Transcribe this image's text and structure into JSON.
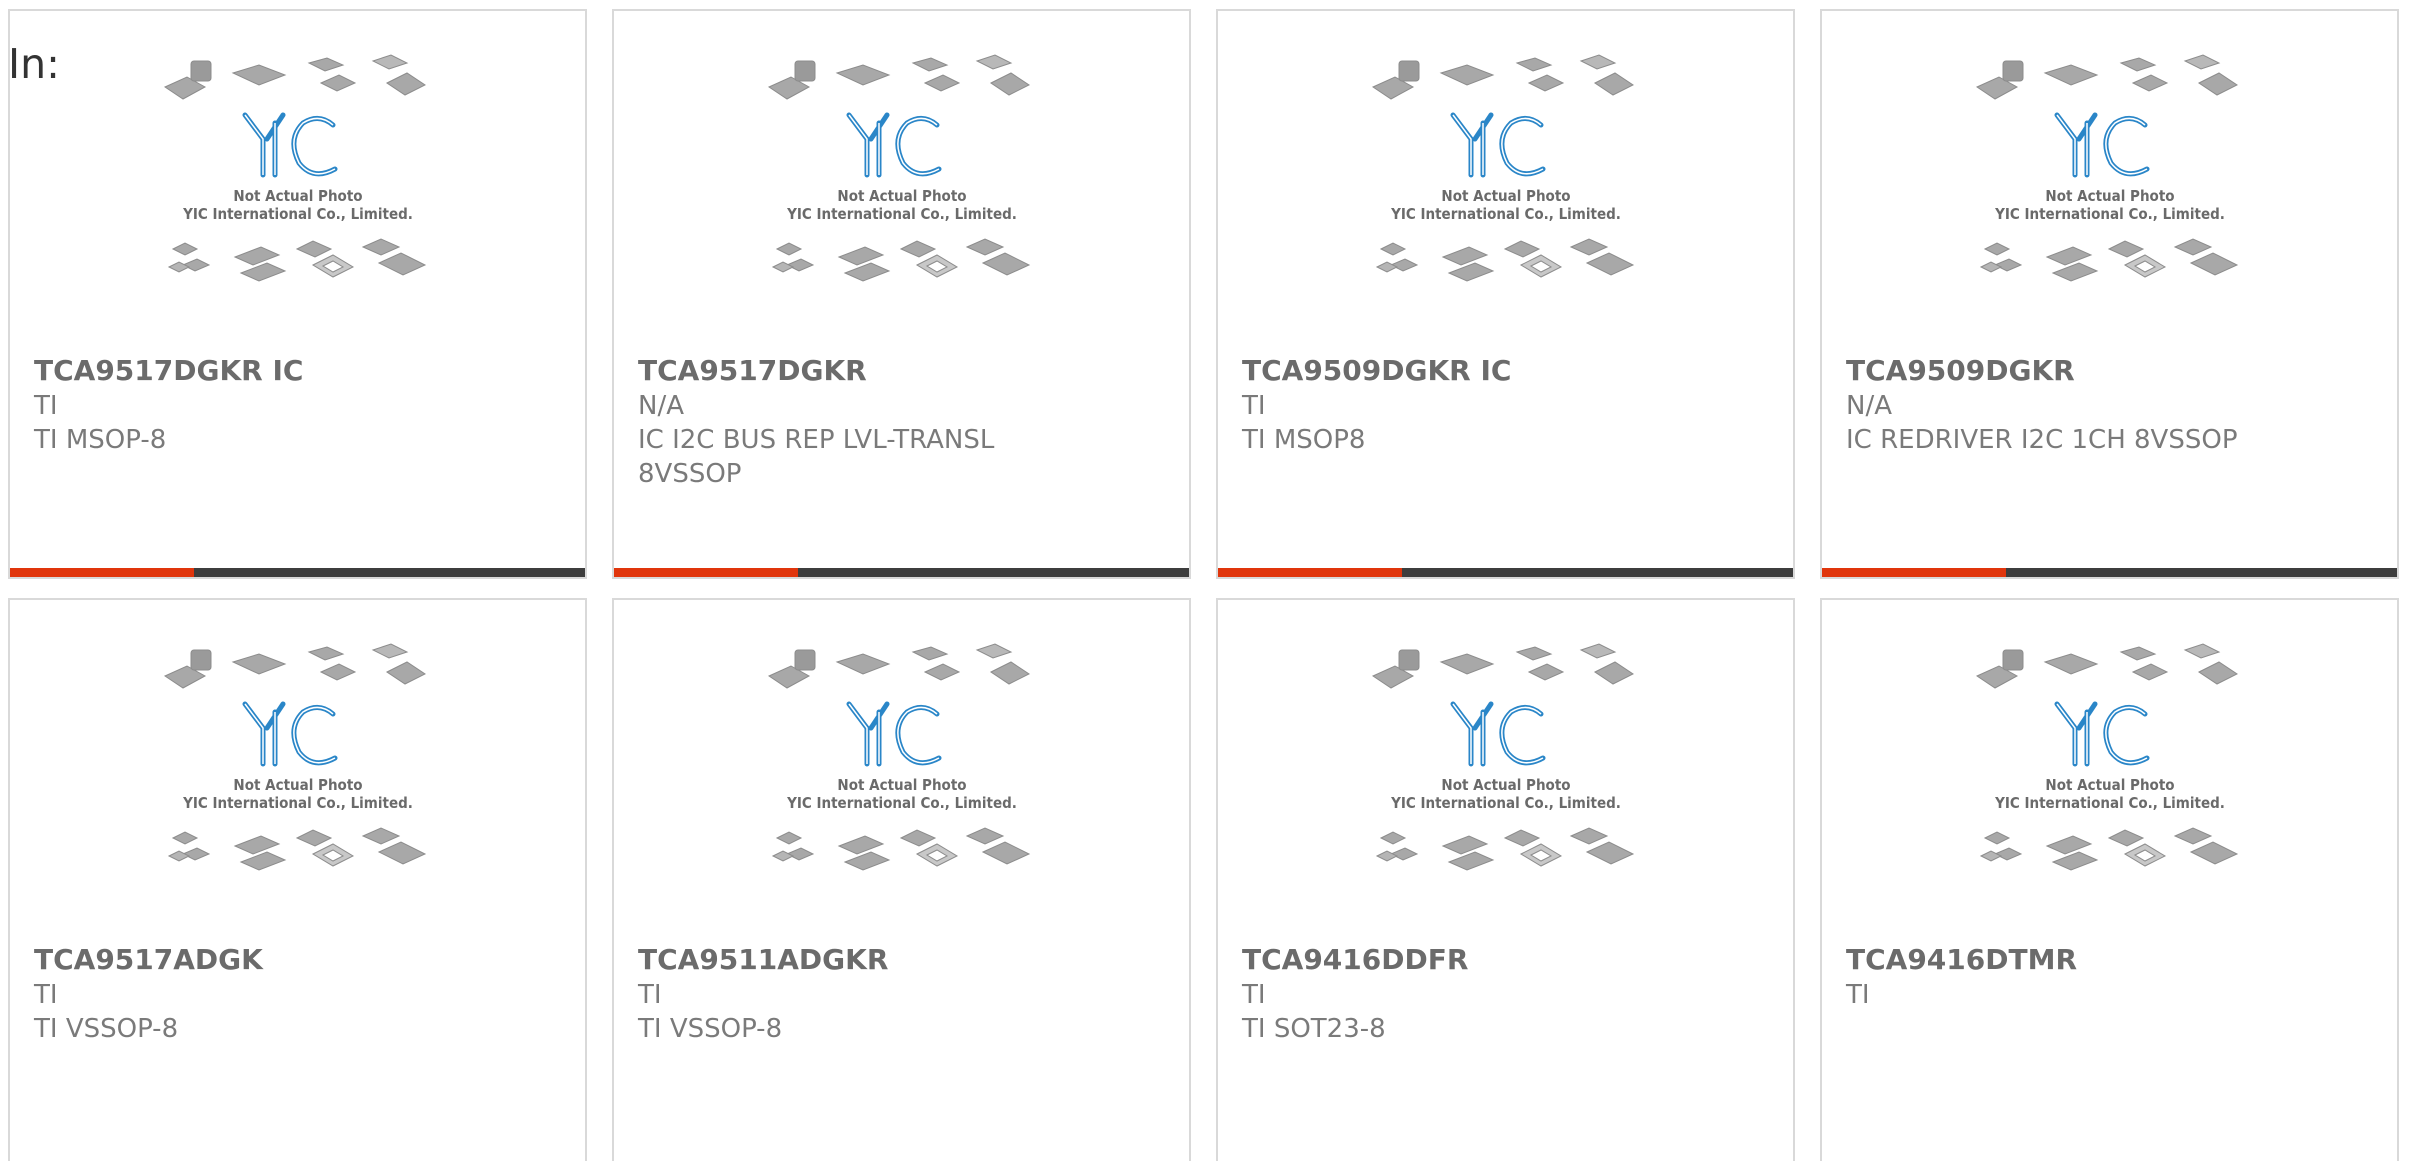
{
  "heading": "In:",
  "placeholder_image": {
    "line1": "Not Actual Photo",
    "line2": "YIC International Co., Limited."
  },
  "colors": {
    "accent": "#e0350c",
    "bar": "#3d3d3d",
    "logo": "#2a86c8"
  },
  "products": [
    {
      "title": "TCA9517DGKR IC",
      "lines": [
        "TI",
        "TI MSOP-8"
      ]
    },
    {
      "title": "TCA9517DGKR",
      "lines": [
        "N/A",
        "IC I2C BUS REP LVL-TRANSL",
        "8VSSOP"
      ]
    },
    {
      "title": "TCA9509DGKR IC",
      "lines": [
        "TI",
        "TI MSOP8"
      ]
    },
    {
      "title": "TCA9509DGKR",
      "lines": [
        "N/A",
        "IC REDRIVER I2C 1CH 8VSSOP"
      ]
    },
    {
      "title": "TCA9517ADGK",
      "lines": [
        "TI",
        "TI VSSOP-8"
      ]
    },
    {
      "title": "TCA9511ADGKR",
      "lines": [
        "TI",
        "TI VSSOP-8"
      ]
    },
    {
      "title": "TCA9416DDFR",
      "lines": [
        "TI",
        "TI SOT23-8"
      ]
    },
    {
      "title": "TCA9416DTMR",
      "lines": [
        "TI"
      ]
    }
  ]
}
